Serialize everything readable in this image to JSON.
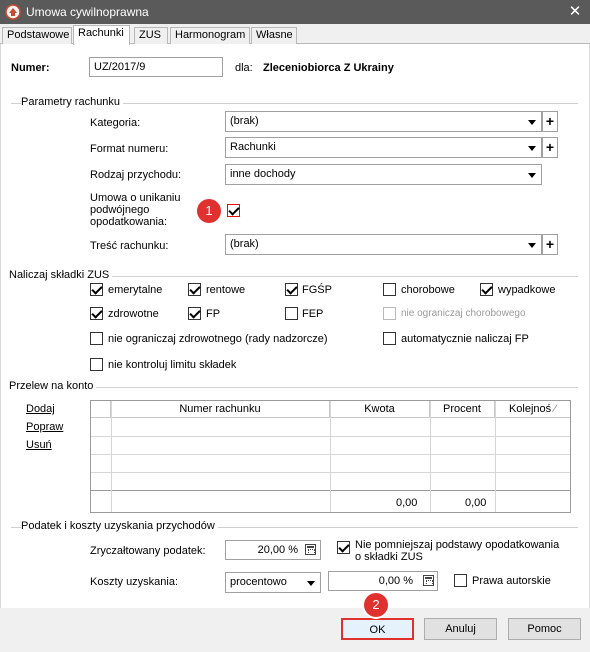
{
  "window": {
    "title": "Umowa cywilnoprawna",
    "close_glyph": "✕"
  },
  "tabs": [
    "Podstawowe",
    "Rachunki",
    "ZUS",
    "Harmonogram",
    "Własne"
  ],
  "header": {
    "numer_label": "Numer:",
    "numer_value": "UZ/2017/9",
    "dla_label": "dla:",
    "dla_value": "Zleceniobiorca Z Ukrainy"
  },
  "parametry": {
    "title": "Parametry rachunku",
    "kategoria_label": "Kategoria:",
    "kategoria_value": "(brak)",
    "format_label": "Format numeru:",
    "format_value": "Rachunki",
    "rodzaj_label": "Rodzaj przychodu:",
    "rodzaj_value": "inne dochody",
    "umowa_line1": "Umowa o unikaniu",
    "umowa_line2": "podwójnego",
    "umowa_line3": "opodatkowania:",
    "tresc_label": "Treść rachunku:",
    "tresc_value": "(brak)",
    "plus_glyph": "+"
  },
  "zus": {
    "title": "Naliczaj składki ZUS",
    "emerytalne": "emerytalne",
    "rentowe": "rentowe",
    "fgsp": "FGŚP",
    "chorobowe": "chorobowe",
    "wypadkowe": "wypadkowe",
    "zdrowotne": "zdrowotne",
    "fp": "FP",
    "fep": "FEP",
    "nie_ogr_chor": "nie ograniczaj chorobowego",
    "nie_ogr_zdr": "nie ograniczaj zdrowotnego (rady nadzorcze)",
    "auto_fp": "automatycznie naliczaj FP",
    "nie_kontroluj": "nie kontroluj limitu składek"
  },
  "przelew": {
    "title": "Przelew na konto",
    "dodaj": "Dodaj",
    "popraw": "Popraw",
    "usun": "Usuń",
    "columns": [
      "Numer rachunku",
      "Kwota",
      "Procent",
      "Kolejnoś"
    ],
    "sort_glyph": "⁄",
    "total_kwota": "0,00",
    "total_procent": "0,00"
  },
  "podatek": {
    "title": "Podatek i koszty uzyskania przychodów",
    "zryczalt_label": "Zryczałtowany podatek:",
    "zryczalt_value": "20,00 %",
    "nie_pomniejszaj_line1": "Nie pomniejszaj podstawy opodatkowania",
    "nie_pomniejszaj_line2": "o składki ZUS",
    "koszty_label": "Koszty uzyskania:",
    "koszty_type": "procentowo",
    "koszty_value": "0,00 %",
    "prawa_autorskie": "Prawa autorskie"
  },
  "buttons": {
    "ok": "OK",
    "anuluj": "Anuluj",
    "pomoc": "Pomoc"
  },
  "annotations": {
    "one": "1",
    "two": "2"
  },
  "colors": {
    "annotation": "#e0312e",
    "titlebar": "#5a5a5a"
  }
}
